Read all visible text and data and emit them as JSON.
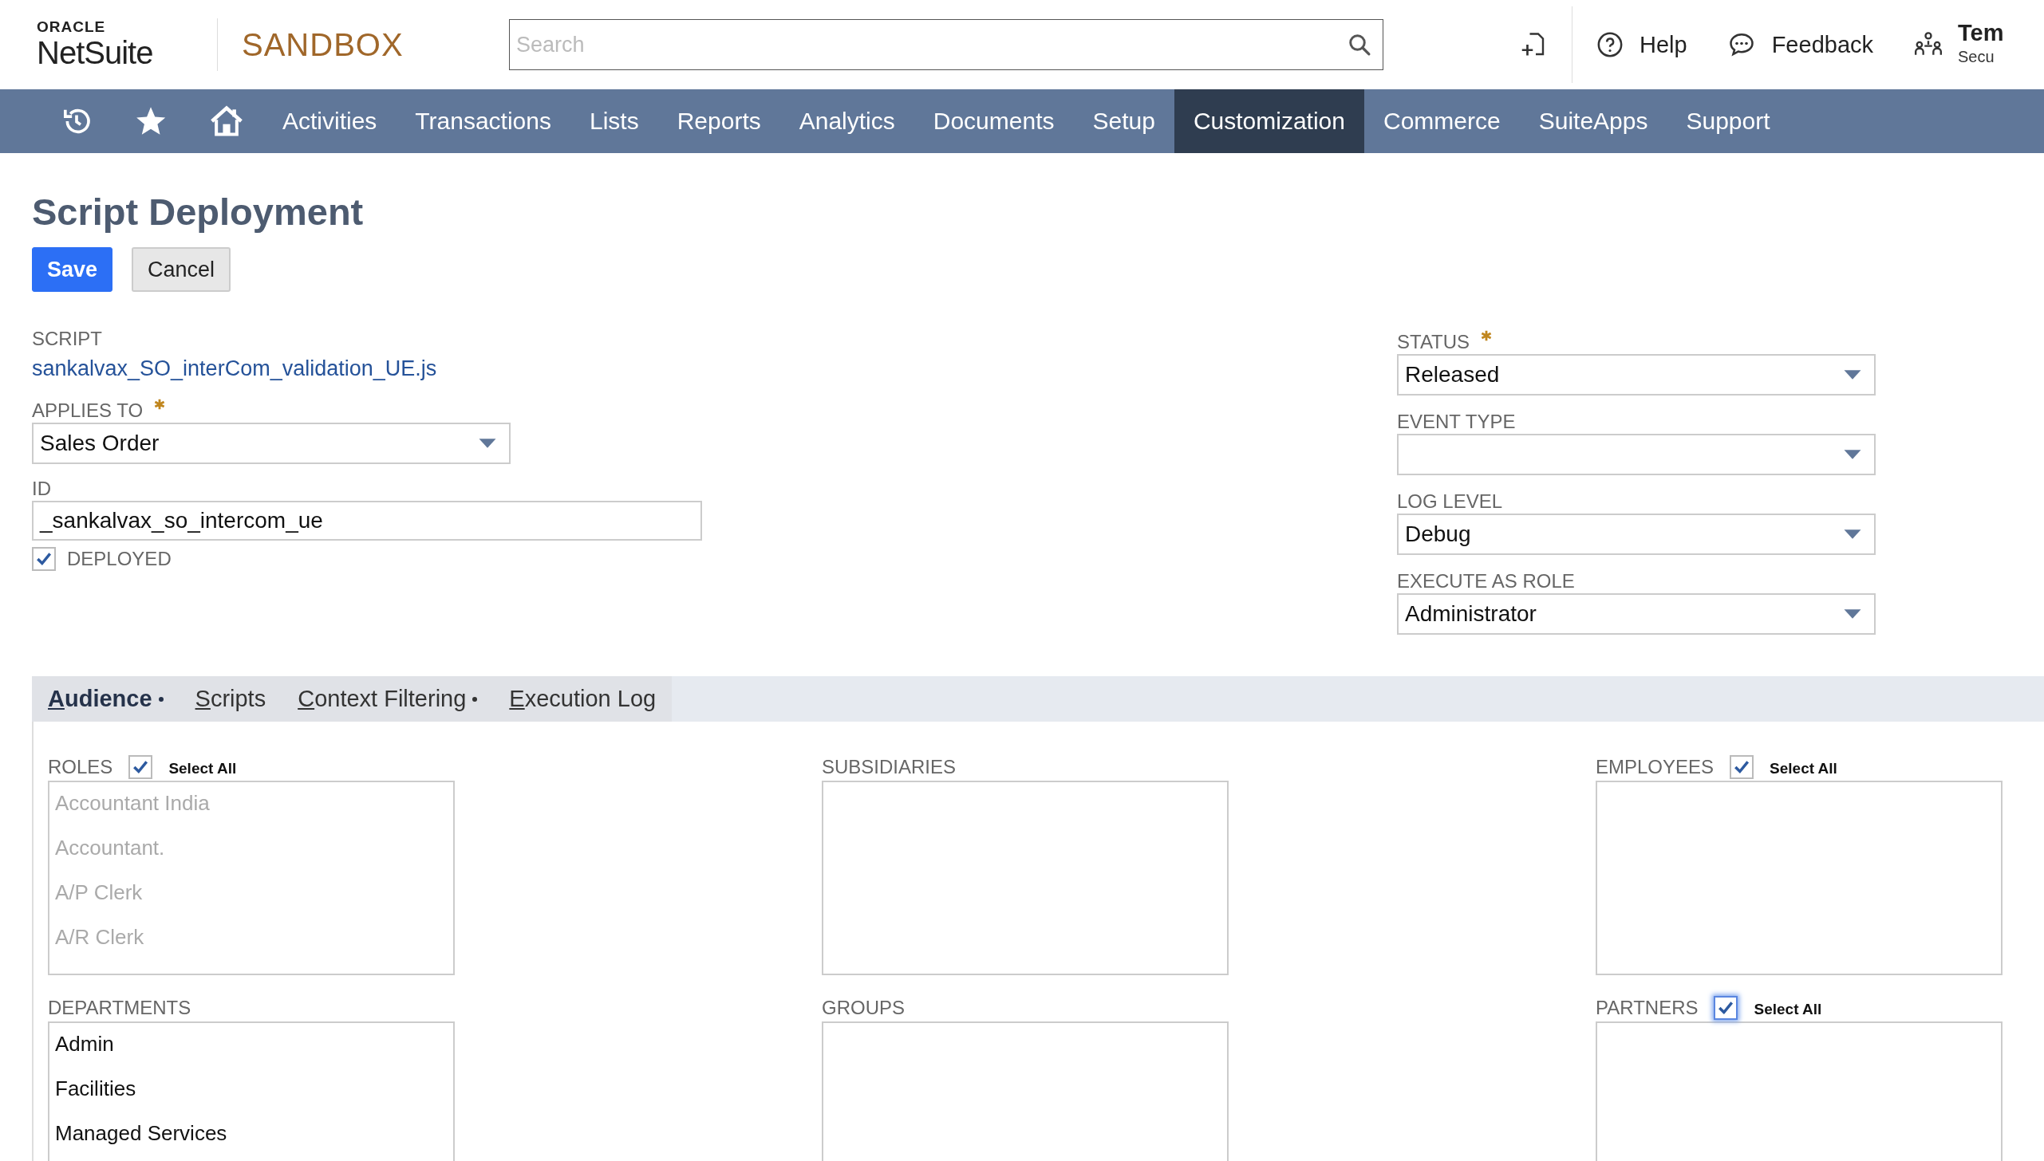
{
  "header": {
    "logo": {
      "top": "ORACLE",
      "bottom": "NetSuite"
    },
    "environment": "SANDBOX",
    "search": {
      "placeholder": "Search"
    },
    "actions": [
      {
        "kind": "help",
        "label": "Help"
      },
      {
        "kind": "feedback",
        "label": "Feedback"
      }
    ],
    "user": {
      "name": "Tem",
      "role": "Secu"
    }
  },
  "nav": {
    "items": [
      {
        "label": "Activities",
        "selected": false
      },
      {
        "label": "Transactions",
        "selected": false
      },
      {
        "label": "Lists",
        "selected": false
      },
      {
        "label": "Reports",
        "selected": false
      },
      {
        "label": "Analytics",
        "selected": false
      },
      {
        "label": "Documents",
        "selected": false
      },
      {
        "label": "Setup",
        "selected": false
      },
      {
        "label": "Customization",
        "selected": true
      },
      {
        "label": "Commerce",
        "selected": false
      },
      {
        "label": "SuiteApps",
        "selected": false
      },
      {
        "label": "Support",
        "selected": false
      }
    ]
  },
  "page": {
    "title": "Script Deployment",
    "buttons": [
      {
        "label": "Save",
        "kind": "primary"
      },
      {
        "label": "Cancel",
        "kind": "secondary"
      }
    ],
    "left_fields": [
      {
        "kind": "link",
        "label": "SCRIPT",
        "value": "sankalvax_SO_interCom_validation_UE.js",
        "required": false
      },
      {
        "kind": "select",
        "label": "APPLIES TO",
        "value": "Sales Order",
        "required": true
      },
      {
        "kind": "text",
        "label": "ID",
        "value": "_sankalvax_so_intercom_ue",
        "required": false
      },
      {
        "kind": "checkbox",
        "label": "DEPLOYED",
        "checked": true
      }
    ],
    "right_fields": [
      {
        "kind": "select",
        "label": "STATUS",
        "value": "Released",
        "required": true
      },
      {
        "kind": "select",
        "label": "EVENT TYPE",
        "required": false
      },
      {
        "kind": "select",
        "label": "LOG LEVEL",
        "value": "Debug",
        "required": false
      },
      {
        "kind": "select",
        "label": "EXECUTE AS ROLE",
        "value": "Administrator",
        "required": false
      }
    ]
  },
  "subtabs": [
    {
      "label": "Audience",
      "selected": true,
      "marked": true
    },
    {
      "label": "Scripts",
      "selected": false,
      "marked": false
    },
    {
      "label": "Context Filtering",
      "selected": false,
      "marked": true
    },
    {
      "label": "Execution Log",
      "selected": false,
      "marked": false
    }
  ],
  "audience": {
    "columns": [
      {
        "groups": [
          {
            "label": "ROLES",
            "select_all": {
              "label": "Select All",
              "checked": true,
              "focused": false
            },
            "items": [
              {
                "label": "Accountant India",
                "disabled": true
              },
              {
                "label": "Accountant.",
                "disabled": true
              },
              {
                "label": "A/P Clerk",
                "disabled": true
              },
              {
                "label": "A/R Clerk",
                "disabled": true
              }
            ]
          },
          {
            "label": "DEPARTMENTS",
            "items": [
              {
                "label": "Admin",
                "disabled": false
              },
              {
                "label": "Facilities",
                "disabled": false
              },
              {
                "label": "Managed Services",
                "disabled": false
              }
            ]
          }
        ]
      },
      {
        "groups": [
          {
            "label": "SUBSIDIARIES"
          },
          {
            "label": "GROUPS"
          }
        ]
      },
      {
        "groups": [
          {
            "label": "EMPLOYEES",
            "select_all": {
              "label": "Select All",
              "checked": true,
              "focused": false
            }
          },
          {
            "label": "PARTNERS",
            "select_all": {
              "label": "Select All",
              "checked": true,
              "focused": true
            }
          }
        ]
      }
    ]
  }
}
